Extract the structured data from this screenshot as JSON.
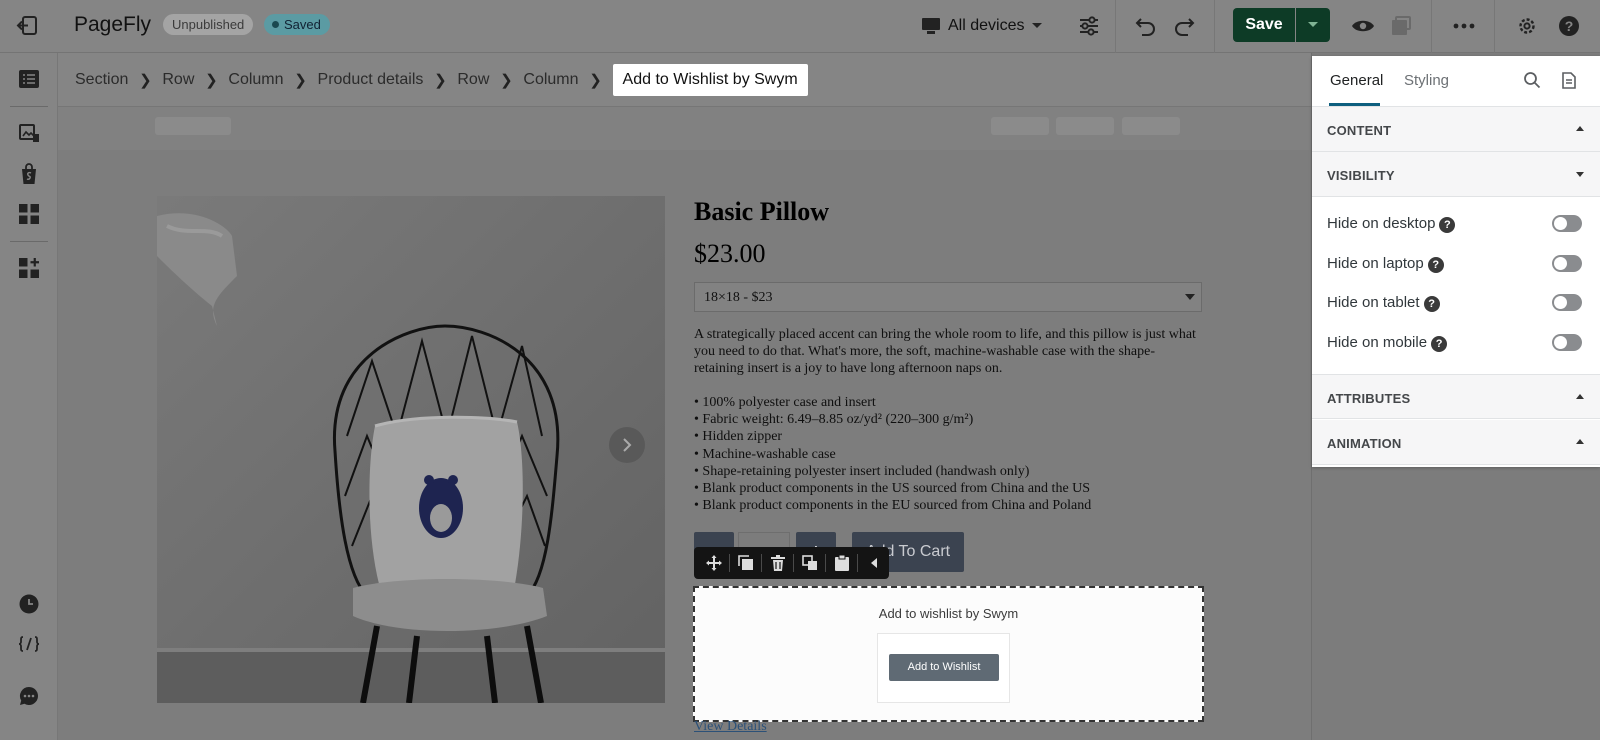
{
  "app": {
    "name": "PageFly",
    "status_badge": "Unpublished",
    "saved_badge": "Saved",
    "device_selector": "All devices",
    "save_label": "Save"
  },
  "breadcrumb": [
    "Section",
    "Row",
    "Column",
    "Product details",
    "Row",
    "Column",
    "Add to Wishlist by Swym"
  ],
  "product": {
    "title": "Basic Pillow",
    "price": "$23.00",
    "variant": "18×18 - $23",
    "description": "A strategically placed accent can bring the whole room to life, and this pillow is just what you need to do that. What's more, the soft, machine-washable case with the shape-retaining insert is a joy to have long afternoon naps on.",
    "bullets": [
      "• 100% polyester case and insert",
      "• Fabric weight: 6.49–8.85 oz/yd² (220–300 g/m²)",
      "• Hidden zipper",
      "• Machine-washable case",
      "• Shape-retaining polyester insert included (handwash only)",
      "• Blank product components in the US sourced from China and the US",
      "• Blank product components in the EU sourced from China and Poland"
    ],
    "add_to_cart": "Add To Cart",
    "minus": "-",
    "plus": "+",
    "view_details": "View Details"
  },
  "wishlist": {
    "label": "Add to wishlist by Swym",
    "button": "Add to Wishlist"
  },
  "panel": {
    "tabs": [
      "General",
      "Styling"
    ],
    "active_tab": "General",
    "sections": {
      "content": "CONTENT",
      "visibility": "VISIBILITY",
      "attributes": "ATTRIBUTES",
      "animation": "ANIMATION"
    },
    "visibility_rows": [
      {
        "label": "Hide on desktop",
        "enabled": false
      },
      {
        "label": "Hide on laptop",
        "enabled": false
      },
      {
        "label": "Hide on tablet",
        "enabled": false
      },
      {
        "label": "Hide on mobile",
        "enabled": false
      }
    ]
  },
  "colors": {
    "save_button": "#0d3b26",
    "saved_badge": "#5b9ba3",
    "tab_underline": "#0e5f7f"
  }
}
